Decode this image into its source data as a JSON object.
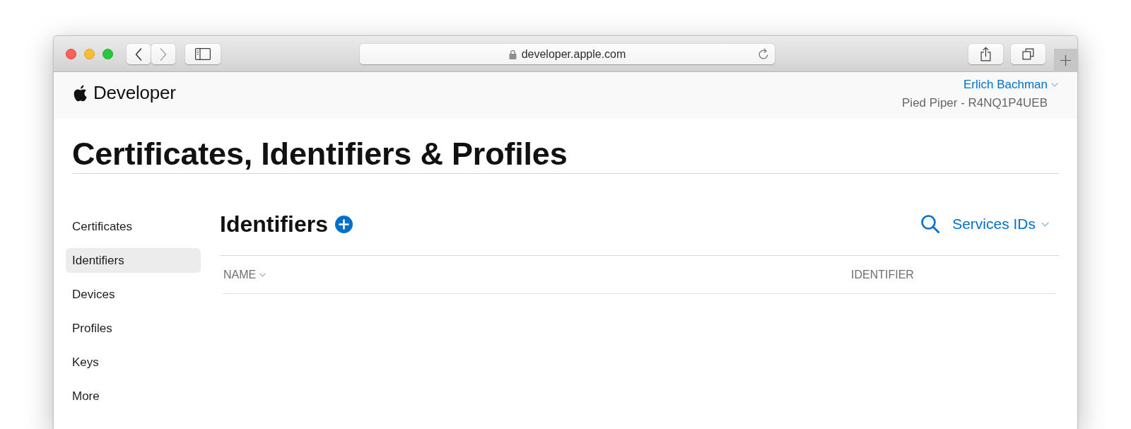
{
  "browser": {
    "url": "developer.apple.com",
    "nav_buttons": [
      {
        "kind": "back",
        "disabled": false
      },
      {
        "kind": "forward",
        "disabled": true
      }
    ]
  },
  "header": {
    "brand": "Developer",
    "account": {
      "name": "Erlich Bachman",
      "team": "Pied Piper - R4NQ1P4UEB"
    }
  },
  "page_title": "Certificates, Identifiers & Profiles",
  "sidebar": {
    "items": [
      {
        "label": "Certificates",
        "selected": false
      },
      {
        "label": "Identifiers",
        "selected": true
      },
      {
        "label": "Devices",
        "selected": false
      },
      {
        "label": "Profiles",
        "selected": false
      },
      {
        "label": "Keys",
        "selected": false
      },
      {
        "label": "More",
        "selected": false
      }
    ]
  },
  "content": {
    "title": "Identifiers",
    "filter": "Services IDs",
    "table": {
      "columns": [
        {
          "label": "NAME",
          "sorted": true
        },
        {
          "label": "IDENTIFIER",
          "sorted": false
        }
      ]
    }
  }
}
